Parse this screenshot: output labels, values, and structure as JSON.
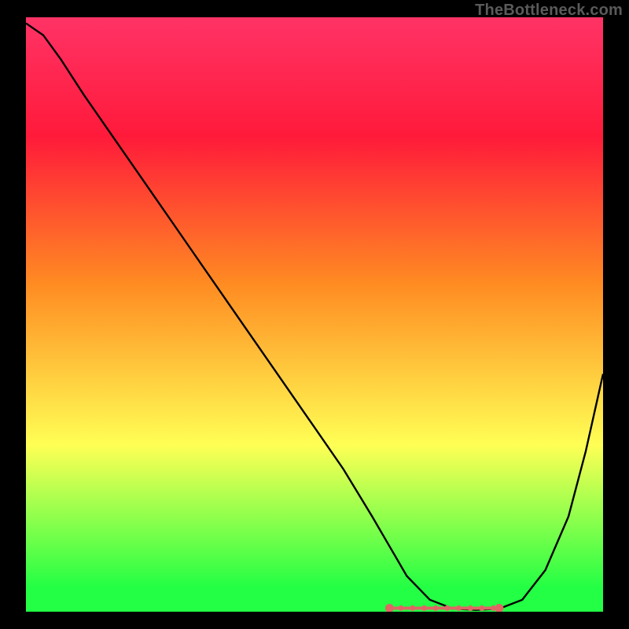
{
  "watermark": "TheBottleneck.com",
  "colors": {
    "frame": "#000000",
    "curve": "#000000",
    "markers": "#e06666",
    "green": "#22ff44",
    "yellow": "#ffff55",
    "orange": "#ff8c22",
    "red": "#ff1a3a",
    "pink": "#ff3366"
  },
  "chart_data": {
    "type": "line",
    "title": "",
    "xlabel": "",
    "ylabel": "",
    "xlim": [
      0,
      100
    ],
    "ylim": [
      0,
      100
    ],
    "grid": false,
    "legend": false,
    "background_gradient": [
      {
        "stop": 0,
        "color": "#ff3366"
      },
      {
        "stop": 20,
        "color": "#ff1a3a"
      },
      {
        "stop": 45,
        "color": "#ff8c22"
      },
      {
        "stop": 72,
        "color": "#ffff55"
      },
      {
        "stop": 96,
        "color": "#22ff44"
      },
      {
        "stop": 100,
        "color": "#22ff44"
      }
    ],
    "series": [
      {
        "name": "bottleneck-curve",
        "x": [
          0,
          3,
          6,
          10,
          15,
          20,
          25,
          30,
          35,
          40,
          45,
          50,
          55,
          60,
          63,
          66,
          70,
          74,
          78,
          82,
          86,
          90,
          94,
          97,
          100
        ],
        "y": [
          99,
          97,
          93,
          87,
          80,
          73,
          66,
          59,
          52,
          45,
          38,
          31,
          24,
          16,
          11,
          6,
          2,
          0.5,
          0.3,
          0.5,
          2,
          7,
          16,
          27,
          40
        ]
      }
    ],
    "optimal_range": {
      "x_start": 63,
      "x_end": 82,
      "y": 0.6,
      "marker_x": [
        63,
        65,
        67,
        69,
        71,
        73,
        75,
        77,
        79,
        81,
        82
      ]
    }
  }
}
